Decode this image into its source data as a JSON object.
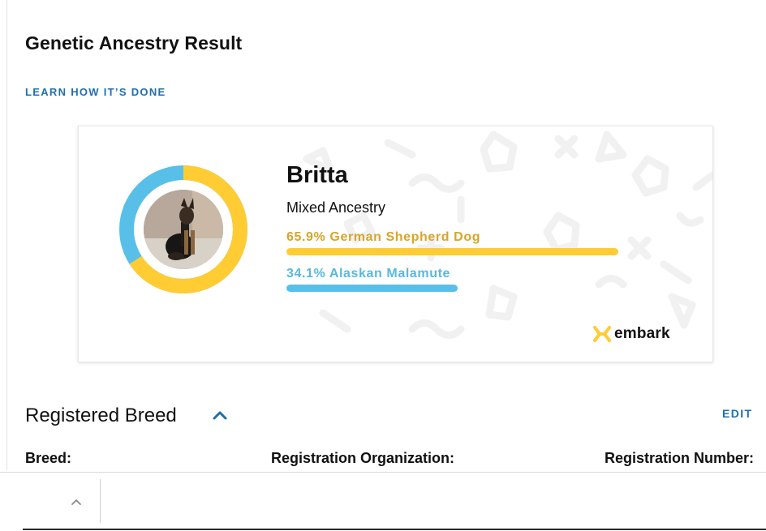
{
  "page": {
    "title": "Genetic Ancestry Result",
    "learn_link": "LEARN HOW IT’S DONE"
  },
  "result_card": {
    "dog_name": "Britta",
    "ancestry_type": "Mixed Ancestry",
    "breeds": [
      {
        "label": "65.9% German Shepherd Dog",
        "percent": 65.9,
        "color": "#ffcc33",
        "text_color": "#d8a52a"
      },
      {
        "label": "34.1% Alaskan Malamute",
        "percent": 34.1,
        "color": "#58c0e8",
        "text_color": "#58b9e0"
      }
    ],
    "logo_text": "embark",
    "logo_color": "#ffcc33"
  },
  "registered_breed": {
    "title": "Registered Breed",
    "edit_label": "EDIT",
    "fields": {
      "breed": "Breed:",
      "organization": "Registration Organization:",
      "number": "Registration Number:"
    }
  },
  "colors": {
    "accent_link": "#1f6fae"
  }
}
